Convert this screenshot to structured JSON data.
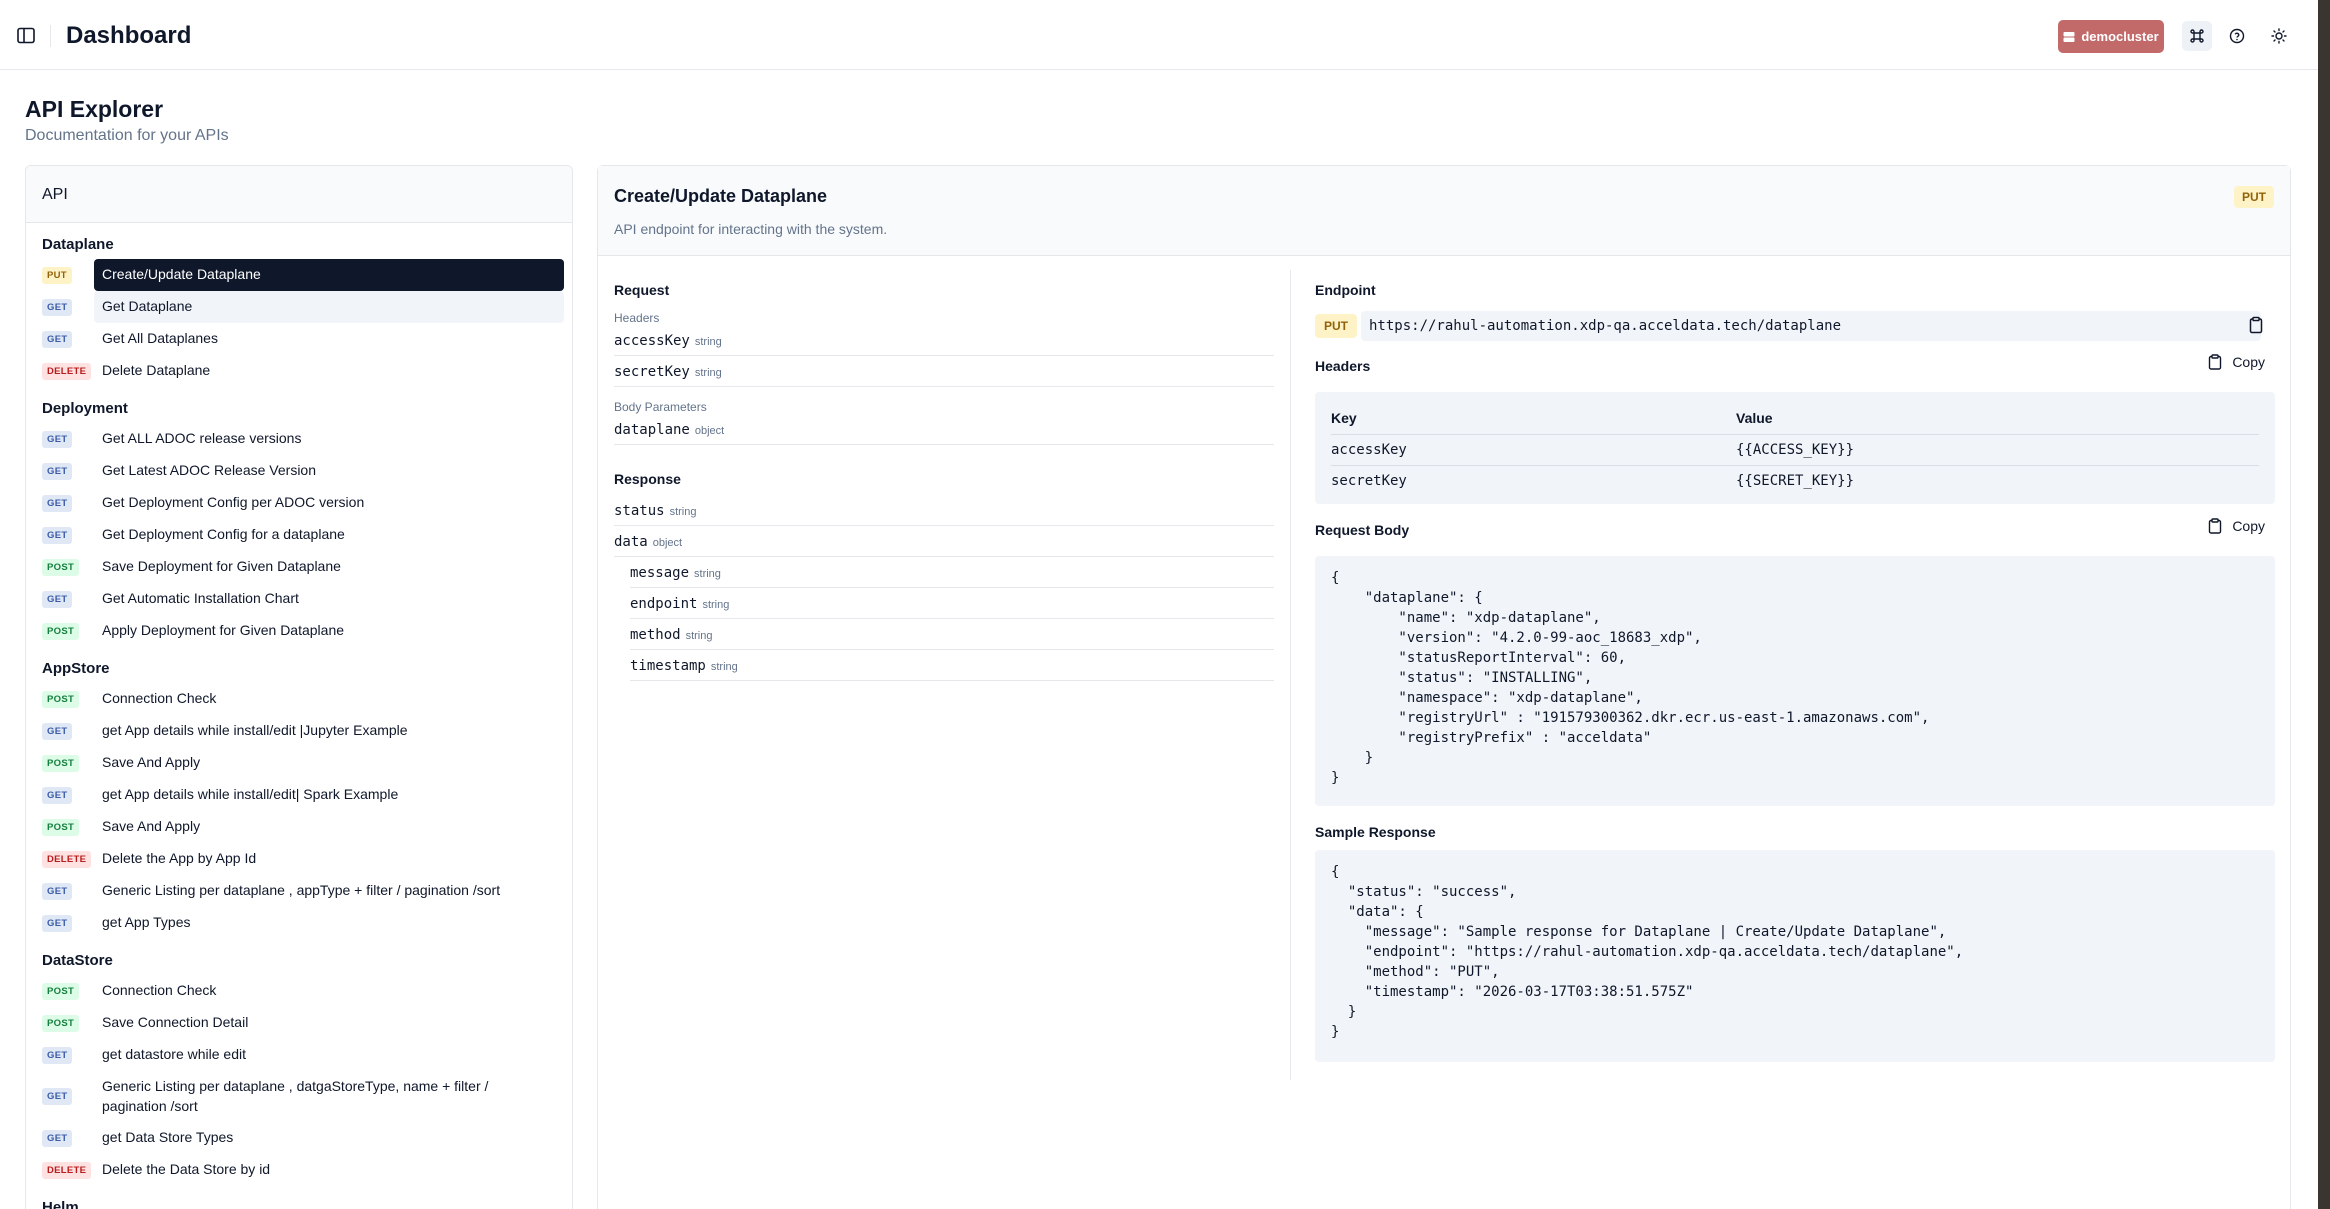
{
  "header": {
    "title": "Dashboard",
    "cluster": "democluster"
  },
  "page": {
    "title": "API Explorer",
    "subtitle": "Documentation for your APIs"
  },
  "api_panel": {
    "title": "API",
    "groups": [
      {
        "title": "Dataplane",
        "items": [
          {
            "method": "PUT",
            "label": "Create/Update Dataplane",
            "selected": true
          },
          {
            "method": "GET",
            "label": "Get Dataplane",
            "hover": true
          },
          {
            "method": "GET",
            "label": "Get All Dataplanes"
          },
          {
            "method": "DELETE",
            "label": "Delete Dataplane"
          }
        ]
      },
      {
        "title": "Deployment",
        "items": [
          {
            "method": "GET",
            "label": "Get ALL ADOC release versions"
          },
          {
            "method": "GET",
            "label": "Get Latest ADOC Release Version"
          },
          {
            "method": "GET",
            "label": "Get Deployment Config per ADOC version"
          },
          {
            "method": "GET",
            "label": "Get Deployment Config for a dataplane"
          },
          {
            "method": "POST",
            "label": "Save Deployment for Given Dataplane"
          },
          {
            "method": "GET",
            "label": "Get Automatic Installation Chart"
          },
          {
            "method": "POST",
            "label": "Apply Deployment for Given Dataplane"
          }
        ]
      },
      {
        "title": "AppStore",
        "items": [
          {
            "method": "POST",
            "label": "Connection Check"
          },
          {
            "method": "GET",
            "label": "get App details while install/edit |Jupyter Example"
          },
          {
            "method": "POST",
            "label": "Save And Apply"
          },
          {
            "method": "GET",
            "label": "get App details while install/edit| Spark Example"
          },
          {
            "method": "POST",
            "label": "Save And Apply"
          },
          {
            "method": "DELETE",
            "label": "Delete the App by App Id"
          },
          {
            "method": "GET",
            "label": "Generic Listing per dataplane , appType + filter / pagination /sort"
          },
          {
            "method": "GET",
            "label": "get App Types"
          }
        ]
      },
      {
        "title": "DataStore",
        "items": [
          {
            "method": "POST",
            "label": "Connection Check"
          },
          {
            "method": "POST",
            "label": "Save Connection Detail"
          },
          {
            "method": "GET",
            "label": "get datastore while edit"
          },
          {
            "method": "GET",
            "label": "Generic Listing per dataplane , datgaStoreType, name + filter / pagination /sort"
          },
          {
            "method": "GET",
            "label": "get Data Store Types"
          },
          {
            "method": "DELETE",
            "label": "Delete the Data Store by id"
          }
        ]
      },
      {
        "title": "Helm",
        "items": []
      }
    ]
  },
  "endpoint": {
    "title": "Create/Update Dataplane",
    "description": "API endpoint for interacting with the system.",
    "method": "PUT",
    "request_label": "Request",
    "headers_label": "Headers",
    "body_params_label": "Body Parameters",
    "response_label": "Response",
    "request_headers": [
      {
        "name": "accessKey",
        "type": "string"
      },
      {
        "name": "secretKey",
        "type": "string"
      }
    ],
    "body_params": [
      {
        "name": "dataplane",
        "type": "object"
      }
    ],
    "response_fields": [
      {
        "name": "status",
        "type": "string"
      },
      {
        "name": "data",
        "type": "object"
      }
    ],
    "response_nested": [
      {
        "name": "message",
        "type": "string"
      },
      {
        "name": "endpoint",
        "type": "string"
      },
      {
        "name": "method",
        "type": "string"
      },
      {
        "name": "timestamp",
        "type": "string"
      }
    ],
    "endpoint_label": "Endpoint",
    "url": "https://rahul-automation.xdp-qa.acceldata.tech/dataplane",
    "headers_section_label": "Headers",
    "copy_label": "Copy",
    "kv_header_key": "Key",
    "kv_header_value": "Value",
    "kv_rows": [
      {
        "key": "accessKey",
        "value": "{{ACCESS_KEY}}"
      },
      {
        "key": "secretKey",
        "value": "{{SECRET_KEY}}"
      }
    ],
    "request_body_label": "Request Body",
    "request_body": "{\n    \"dataplane\": {\n        \"name\": \"xdp-dataplane\",\n        \"version\": \"4.2.0-99-aoc_18683_xdp\",\n        \"statusReportInterval\": 60,\n        \"status\": \"INSTALLING\",\n        \"namespace\": \"xdp-dataplane\",\n        \"registryUrl\" : \"191579300362.dkr.ecr.us-east-1.amazonaws.com\",\n        \"registryPrefix\" : \"acceldata\"\n    }\n}",
    "sample_response_label": "Sample Response",
    "sample_response": "{\n  \"status\": \"success\",\n  \"data\": {\n    \"message\": \"Sample response for Dataplane | Create/Update Dataplane\",\n    \"endpoint\": \"https://rahul-automation.xdp-qa.acceldata.tech/dataplane\",\n    \"method\": \"PUT\",\n    \"timestamp\": \"2026-03-17T03:38:51.575Z\"\n  }\n}"
  }
}
